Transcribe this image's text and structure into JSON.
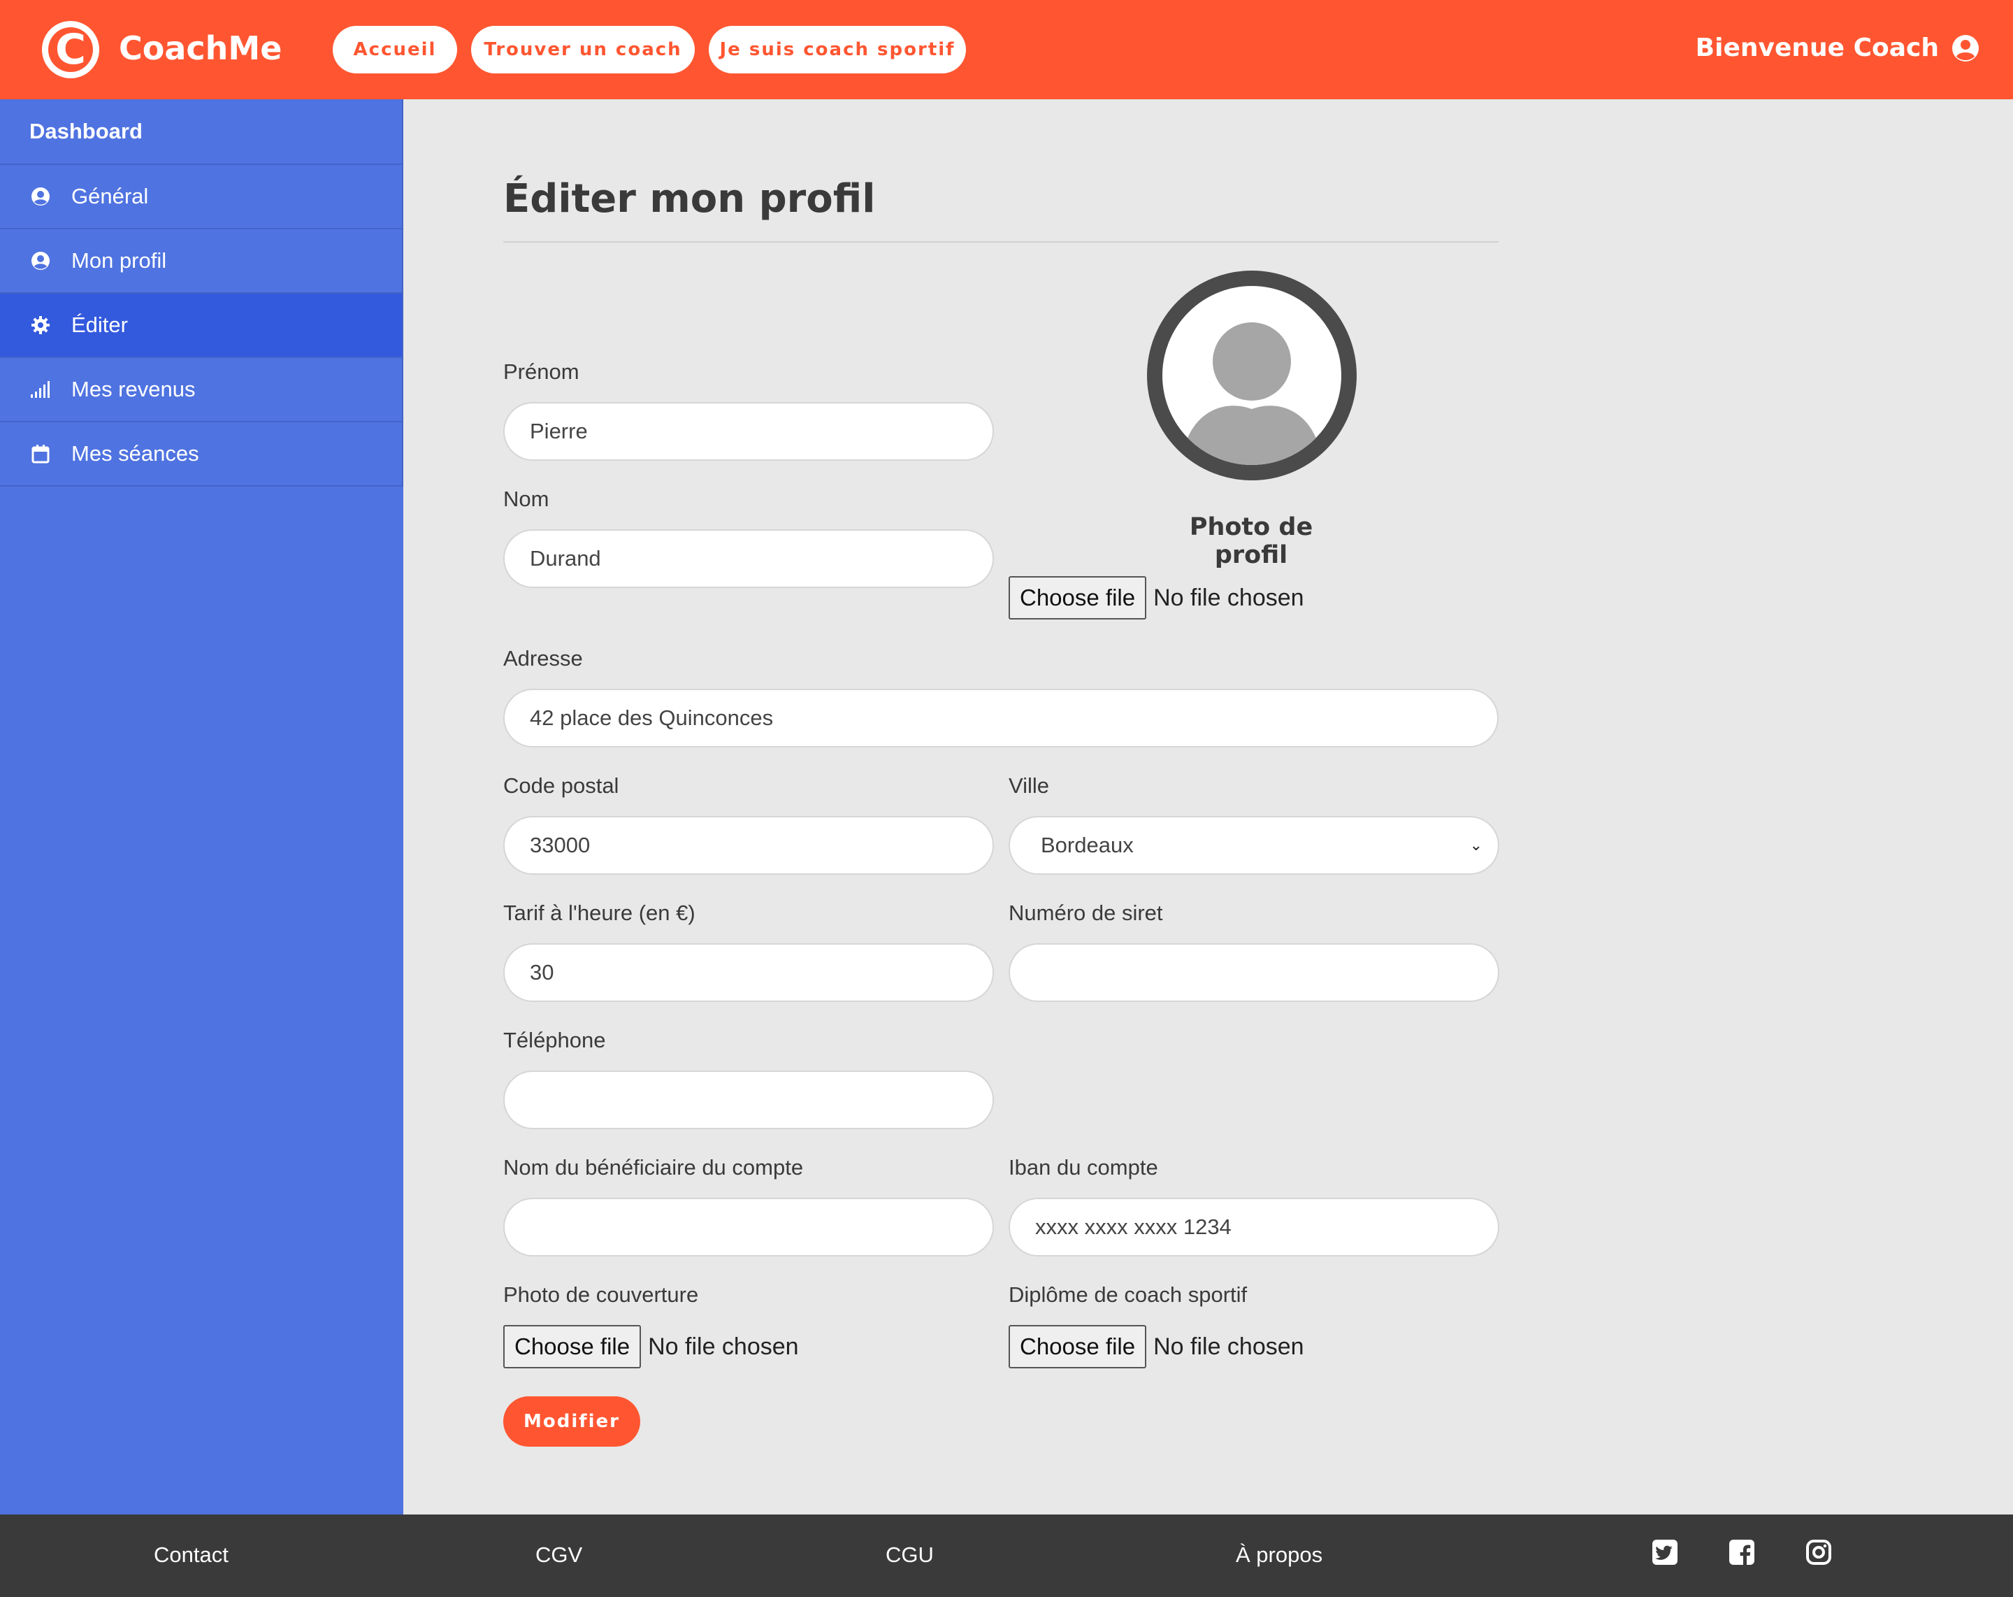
{
  "header": {
    "logo_letter": "C",
    "brand": "CoachMe",
    "nav": [
      "Accueil",
      "Trouver un coach",
      "Je suis coach sportif"
    ],
    "welcome": "Bienvenue Coach",
    "accent_color": "#ff5631"
  },
  "sidebar": {
    "title": "Dashboard",
    "items": [
      {
        "label": "Général",
        "icon": "user-circle-icon"
      },
      {
        "label": "Mon profil",
        "icon": "user-circle-icon"
      },
      {
        "label": "Éditer",
        "icon": "gear-icon",
        "active": true
      },
      {
        "label": "Mes revenus",
        "icon": "signal-bars-icon"
      },
      {
        "label": "Mes séances",
        "icon": "calendar-icon"
      }
    ],
    "color": "#4f73e0"
  },
  "form": {
    "title": "Éditer mon profil",
    "photo_label": "Photo de profil",
    "file_button": "Choose file",
    "file_status": "No file chosen",
    "prenom": {
      "label": "Prénom",
      "value": "Pierre"
    },
    "nom": {
      "label": "Nom",
      "value": "Durand"
    },
    "adresse": {
      "label": "Adresse",
      "value": "42 place des Quinconces"
    },
    "code_postal": {
      "label": "Code postal",
      "value": "33000"
    },
    "ville": {
      "label": "Ville",
      "value": "Bordeaux"
    },
    "tarif": {
      "label": "Tarif à l'heure (en €)",
      "value": "30"
    },
    "siret": {
      "label": "Numéro de siret",
      "value": ""
    },
    "telephone": {
      "label": "Téléphone",
      "value": ""
    },
    "beneficiaire": {
      "label": "Nom du bénéficiaire du compte",
      "value": ""
    },
    "iban": {
      "label": "Iban du compte",
      "value": "xxxx xxxx xxxx 1234"
    },
    "couverture": {
      "label": "Photo de couverture"
    },
    "diplome": {
      "label": "Diplôme de coach sportif"
    },
    "submit": "Modifier"
  },
  "footer": {
    "links": [
      "Contact",
      "CGV",
      "CGU",
      "À propos"
    ],
    "social": [
      "twitter-icon",
      "facebook-icon",
      "instagram-icon"
    ]
  }
}
